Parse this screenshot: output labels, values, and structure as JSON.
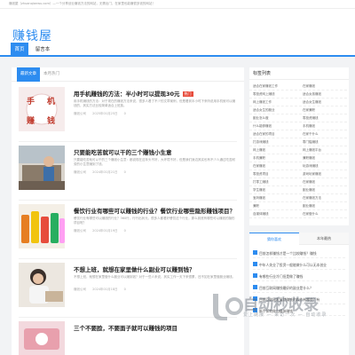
{
  "topbar": {
    "text": "赚钱屋（zhuanqianwu.com）—一个分享创业赚钱方法的网站，无需出门，在家里也能赚很多钱的网站！"
  },
  "site": {
    "logo": "赚钱屋"
  },
  "nav": {
    "items": [
      {
        "label": "首页",
        "active": true
      },
      {
        "label": "留言本",
        "active": false
      }
    ]
  },
  "main": {
    "tabs": [
      {
        "label": "最新文章"
      },
      {
        "label": "本月热门"
      }
    ],
    "posts": [
      {
        "title": "用手机赚钱的方法：半小时可以提现30元",
        "badge": "热门",
        "excerpt": "用手机赚钱的方法：对于现在的赚钱方法来说，很多人看了不少的文章案例，但是看到半小时下来听说用手机就可以赚钱的，其实方法比较简单适合上班族。",
        "author": "赚钱公司",
        "date": "2025年01月25日",
        "views": "0",
        "thumb_text": [
          "手",
          "机",
          "赚",
          "钱"
        ]
      },
      {
        "title": "只要能吃苦就可以干的三个赚钱小生意",
        "excerpt": "只要能吃苦就可以干的三个赚钱小生意：都说现在这年头不好，大环境不好，但是我们身边其实也有不少人通过吃苦耐劳的小生意赚到了钱。",
        "author": "赚钱公司",
        "date": "2024年01月21日",
        "views": "0"
      },
      {
        "title": "餐饮行业有哪些可以赚钱的行业？餐饮行业哪些隐形赚钱项目？",
        "excerpt": "餐饮行业有哪些可以赚钱的行业？360行，行行出状元，很多人都看好餐饮这个行业，那么到底有哪些可以赚钱的隐形项目呢？",
        "author": "赚钱公司",
        "date": "2024年01月19日",
        "views": "0"
      },
      {
        "title": "不想上班，就想在家里做什么副业可以赚到钱？",
        "excerpt": "不想上班，就想在家里做什么副业可以赚到钱？对于一些人来说，其实工作一天下来很累，还不如在家里做副业赚钱。",
        "author": "赚钱公司",
        "date": "2024年01月18日",
        "views": "0"
      },
      {
        "title": "三个不要脸，不要面子就可以赚钱的项目",
        "excerpt": "",
        "author": "",
        "date": "",
        "views": ""
      }
    ]
  },
  "sidebar": {
    "tags_title": "标签列表",
    "tags": [
      "适合在家赚钱工作",
      "在家赚钱",
      "零投资网上赚钱",
      "适合女孩赚钱",
      "网上赚钱工作",
      "适合女生赚钱",
      "适合女生的副业",
      "在家兼职",
      "副业怎么做",
      "零投资赚钱",
      "什么能够赚钱",
      "手机赚钱",
      "适合在家的项目",
      "在家干什么",
      "打游戏赚钱",
      "零门槛赚钱",
      "网上赚钱",
      "网上赚钱平台",
      "手机兼职",
      "兼职赚钱",
      "在家赚钱",
      "玩游戏赚钱",
      "零投资项目",
      "游戏玩家赚钱",
      "打零工赚钱",
      "在家赚钱",
      "学生赚钱",
      "副业赚钱",
      "宝妈赚钱",
      "在家赚钱方法",
      "兼职",
      "副业赚钱",
      "自媒体赚钱",
      "在家做什么"
    ],
    "hot_tabs": [
      {
        "label": "猜你喜欢"
      },
      {
        "label": "本年最热"
      }
    ],
    "hot_items": [
      "目前怎样赚钱才是一个比较赚钱？赚钱",
      "中年人失业了投资一般能做什么可以无本创业",
      "有哪些行业冷门但是做了赚钱",
      "目前互联网赚钱最好的副业是什么？",
      "目前互联网发展就赚钱的软件有哪些？有",
      "新手如何做自媒体赚钱"
    ]
  },
  "watermark": {
    "text": "自动秒收录",
    "sub": "爱上链接 — 来访一次 — 自动收录"
  }
}
